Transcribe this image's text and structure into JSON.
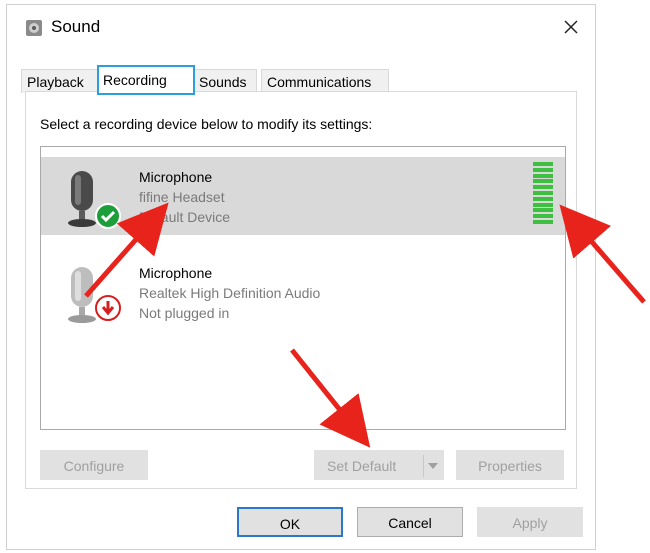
{
  "window": {
    "title": "Sound"
  },
  "tabs": [
    {
      "label": "Playback"
    },
    {
      "label": "Recording"
    },
    {
      "label": "Sounds"
    },
    {
      "label": "Communications"
    }
  ],
  "instructions": "Select a recording device below to modify its settings:",
  "devices": [
    {
      "name": "Microphone",
      "description": "fifine Headset",
      "status": "Default Device",
      "selected": true,
      "status_icon": "check-icon",
      "level": 1.0
    },
    {
      "name": "Microphone",
      "description": "Realtek High Definition Audio",
      "status": "Not plugged in",
      "selected": false,
      "status_icon": "down-arrow-icon"
    }
  ],
  "buttons": {
    "configure": "Configure",
    "set_default": "Set Default",
    "properties": "Properties",
    "ok": "OK",
    "cancel": "Cancel",
    "apply": "Apply"
  },
  "colors": {
    "accent": "#2a9fd8",
    "meter": "#3fbf3f",
    "arrow": "#e8231c",
    "check": "#1c9e3a",
    "unplugged": "#d61e1e"
  }
}
